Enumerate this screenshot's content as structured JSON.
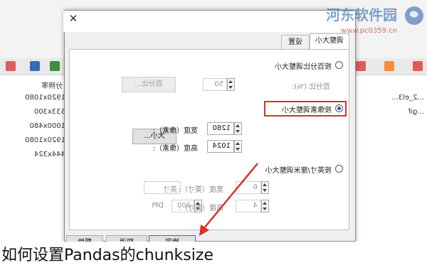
{
  "caption": "如何设置Pandas的chunksize",
  "watermark": {
    "site": "河东软件园",
    "url": "www.pc0359.cn"
  },
  "background_window": {
    "column_header": "分辨率",
    "files": [
      {
        "name": "...2_el3...",
        "resolution": "1920x1080"
      },
      {
        "name": "...gif",
        "resolution": "533x300"
      },
      {
        "name": "",
        "resolution": "1000x480"
      },
      {
        "name": "",
        "resolution": "1920x1080"
      },
      {
        "name": "",
        "resolution": "444x324"
      }
    ]
  },
  "dialog": {
    "title": "调整大小",
    "tabs": [
      "调整大小",
      "设置"
    ],
    "percent": {
      "label": "按百分比调整大小",
      "field_label": "百分比 (%):",
      "value": "50",
      "button": "百分比..."
    },
    "pixels": {
      "label": "按像素调整大小",
      "width_label": "宽度（像素）:",
      "width_value": "1280",
      "height_label": "高度（像素）:",
      "height_value": "1024",
      "button": "大小..."
    },
    "inches": {
      "label": "按英寸/厘米调整大小",
      "unit_value": "英寸",
      "width_label": "宽度（英寸）:",
      "width_value": "6",
      "height_label": "高度（英寸）:",
      "height_value": "4",
      "dpi_value": "300",
      "dpi_label": "DPI"
    },
    "buttons": {
      "ok": "确定",
      "cancel": "取消",
      "help": "帮助"
    }
  },
  "colors": {
    "highlight": "#d9302a",
    "arrow": "#d9302a",
    "radio_selected": "#1a5fb4"
  }
}
